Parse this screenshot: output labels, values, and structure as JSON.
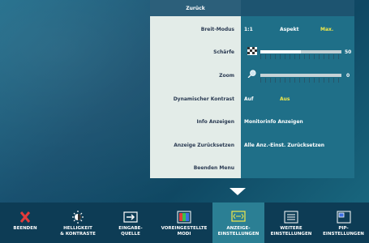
{
  "osd": {
    "back_label": "Zurück",
    "rows": [
      {
        "label": "Breit-Modus",
        "options": [
          "1:1",
          "Aspekt",
          "Max."
        ],
        "selected": 2
      },
      {
        "label": "Schärfe",
        "value_text": "50",
        "level": 0.5
      },
      {
        "label": "Zoom",
        "value_text": "0",
        "level": 0.0
      },
      {
        "label": "Dynamischer Kontrast",
        "options": [
          "Auf",
          "Aus"
        ],
        "selected": 1
      },
      {
        "label": "Info Anzeigen",
        "value_text": "Monitorinfo Anzeigen"
      },
      {
        "label": "Anzeige Zurücksetzen",
        "value_text": "Alle Anz.-Einst. Zurücksetzen"
      },
      {
        "label": "Beenden Menu"
      }
    ]
  },
  "bottom_menu": [
    {
      "label": "BEENDEN",
      "icon": "x-icon"
    },
    {
      "label": "HELLIGKEIT\n& KONTRASTE",
      "icon": "brightness-icon"
    },
    {
      "label": "EINGABE-\nQUELLE",
      "icon": "input-source-icon"
    },
    {
      "label": "VOREINGESTELLTE\nMODI",
      "icon": "preset-modes-icon"
    },
    {
      "label": "ANZEIGE-\nEINSTELLUNGEN",
      "icon": "display-settings-icon",
      "active": true
    },
    {
      "label": "WEITERE\nEINSTELLUNGEN",
      "icon": "other-settings-icon"
    },
    {
      "label": "PIP-\nEINSTELLUNGEN",
      "icon": "pip-settings-icon"
    }
  ],
  "colors": {
    "highlight": "#f2e94a",
    "active_tab": "#2b7f94",
    "close_icon": "#e23b3b"
  }
}
